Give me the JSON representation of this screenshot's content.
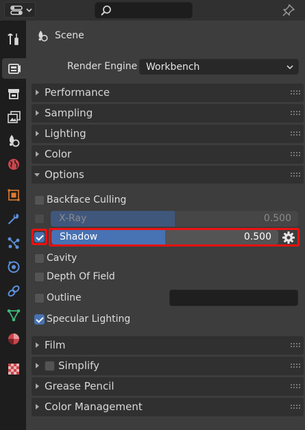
{
  "header": {
    "editor_icon": "properties-editor-icon",
    "search_icon": "search-icon",
    "pin_icon": "pin-icon"
  },
  "tabs": [
    "tool-icon",
    "render-icon",
    "output-icon",
    "view-layer-icon",
    "scene-icon",
    "world-icon",
    "object-icon",
    "modifier-icon",
    "particles-icon",
    "physics-icon",
    "constraints-icon",
    "data-icon",
    "material-icon",
    "texture-icon"
  ],
  "breadcrumb": {
    "label": "Scene"
  },
  "render_engine": {
    "label": "Render Engine",
    "value": "Workbench"
  },
  "sections_top": [
    {
      "label": "Performance"
    },
    {
      "label": "Sampling"
    },
    {
      "label": "Lighting"
    },
    {
      "label": "Color"
    },
    {
      "label": "Options"
    }
  ],
  "options": {
    "backface_culling": {
      "label": "Backface Culling",
      "checked": false
    },
    "xray": {
      "label": "X-Ray",
      "value": "0.500",
      "fraction": 0.5,
      "checked": false
    },
    "shadow": {
      "label": "Shadow",
      "value": "0.500",
      "fraction": 0.5,
      "checked": true
    },
    "cavity": {
      "label": "Cavity",
      "checked": false
    },
    "depth_of_field": {
      "label": "Depth Of Field",
      "checked": false
    },
    "outline": {
      "label": "Outline",
      "checked": false
    },
    "specular_lighting": {
      "label": "Specular Lighting",
      "checked": true
    }
  },
  "sections_bottom": [
    {
      "label": "Film"
    },
    {
      "label": "Simplify"
    },
    {
      "label": "Grease Pencil"
    },
    {
      "label": "Color Management"
    }
  ],
  "colors": {
    "accent": "#4772b3",
    "highlight": "#ee1111",
    "panel": "#3d3d3d",
    "header": "#303030"
  }
}
